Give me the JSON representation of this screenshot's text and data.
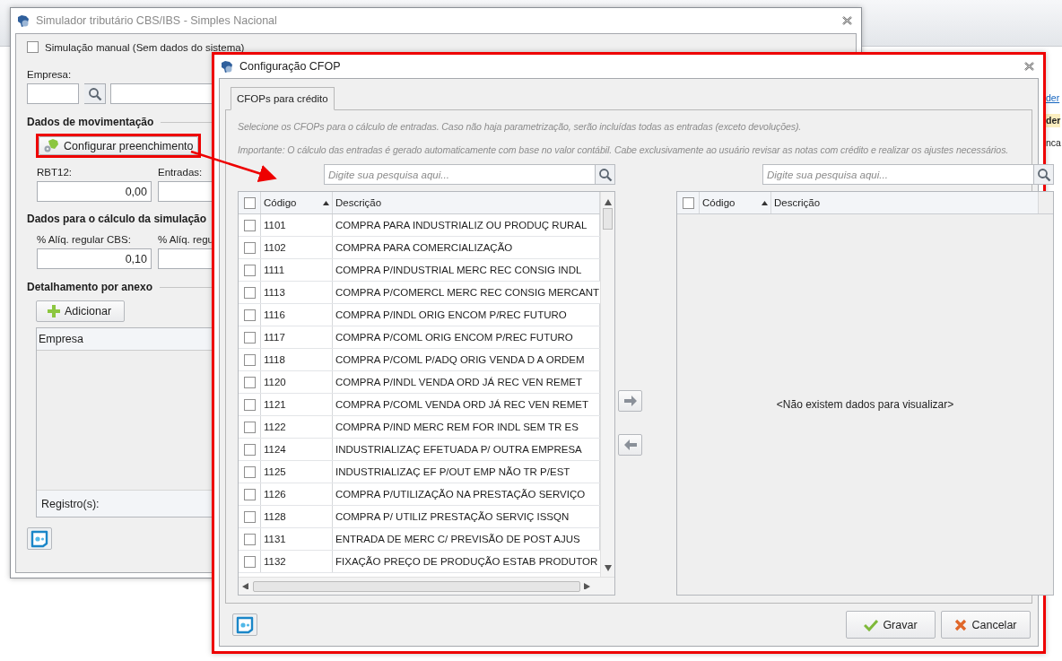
{
  "background": {
    "right_fragments": [
      {
        "text": "der",
        "kind": "link"
      },
      {
        "text": "der",
        "kind": "highlight"
      },
      {
        "text": "nca",
        "kind": "plain"
      }
    ]
  },
  "simulator": {
    "title": "Simulador tributário CBS/IBS - Simples Nacional",
    "manual": {
      "label": "Simulação manual (Sem dados do sistema)",
      "checked": false
    },
    "empresa_label": "Empresa:",
    "section_movement": "Dados de movimentação",
    "configure_button": "Configurar preenchimento",
    "rbt12": {
      "label": "RBT12:",
      "value": "0,00"
    },
    "entradas": {
      "label": "Entradas:"
    },
    "section_calc": "Dados para o cálculo da simulação",
    "cbs": {
      "label": "% Alíq. regular CBS:",
      "value": "0,10"
    },
    "ibs": {
      "label": "% Alíq. regu"
    },
    "section_annex": "Detalhamento por anexo",
    "add_button": "Adicionar",
    "table": {
      "column": "Empresa",
      "footer": "Registro(s):"
    }
  },
  "config": {
    "title": "Configuração CFOP",
    "tabs": [
      {
        "label": "CFOPs para crédito",
        "selected": true
      }
    ],
    "info": [
      "Selecione os CFOPs para o cálculo de entradas. Caso não haja parametrização, serão incluídas todas as entradas (exceto devoluções).",
      "Importante: O cálculo das entradas é gerado automaticamente com base no valor contábil. Cabe exclusivamente ao usuário revisar as notas com crédito e realizar os ajustes necessários."
    ],
    "available": {
      "search": {
        "placeholder": "Digite sua pesquisa aqui..."
      },
      "all_checked": false,
      "columns": [
        "Código",
        "Descrição"
      ],
      "rows": [
        {
          "code": "1101",
          "description": "COMPRA PARA INDUSTRIALIZ OU PRODUÇ RURAL",
          "checked": false
        },
        {
          "code": "1102",
          "description": "COMPRA PARA COMERCIALIZAÇÃO",
          "checked": false
        },
        {
          "code": "1111",
          "description": "COMPRA P/INDUSTRIAL MERC REC CONSIG INDL",
          "checked": false
        },
        {
          "code": "1113",
          "description": "COMPRA P/COMERCL MERC REC CONSIG MERCANT",
          "checked": false
        },
        {
          "code": "1116",
          "description": "COMPRA P/INDL ORIG ENCOM P/REC FUTURO",
          "checked": false
        },
        {
          "code": "1117",
          "description": "COMPRA P/COML ORIG ENCOM P/REC FUTURO",
          "checked": false
        },
        {
          "code": "1118",
          "description": "COMPRA P/COML P/ADQ ORIG VENDA D A ORDEM",
          "checked": false
        },
        {
          "code": "1120",
          "description": "COMPRA P/INDL VENDA ORD JÁ REC VEN REMET",
          "checked": false
        },
        {
          "code": "1121",
          "description": "COMPRA P/COML VENDA ORD JÁ REC VEN REMET",
          "checked": false
        },
        {
          "code": "1122",
          "description": "COMPRA P/IND MERC REM FOR INDL SEM TR ES",
          "checked": false
        },
        {
          "code": "1124",
          "description": "INDUSTRIALIZAÇ EFETUADA P/ OUTRA EMPRESA",
          "checked": false
        },
        {
          "code": "1125",
          "description": "INDUSTRIALIZAÇ EF P/OUT EMP NÃO TR P/EST",
          "checked": false
        },
        {
          "code": "1126",
          "description": "COMPRA P/UTILIZAÇÃO NA PRESTAÇÃO SERVIÇO",
          "checked": false
        },
        {
          "code": "1128",
          "description": "COMPRA P/ UTILIZ PRESTAÇÃO SERVIÇ ISSQN",
          "checked": false
        },
        {
          "code": "1131",
          "description": "ENTRADA DE MERC C/ PREVISÃO DE POST AJUS",
          "checked": false
        },
        {
          "code": "1132",
          "description": "FIXAÇÃO PREÇO DE PRODUÇÃO ESTAB PRODUTOR",
          "checked": false
        }
      ]
    },
    "selected": {
      "search": {
        "placeholder": "Digite sua pesquisa aqui..."
      },
      "all_checked": false,
      "columns": [
        "Código",
        "Descrição"
      ],
      "empty_message": "<Não existem dados para visualizar>"
    },
    "buttons": [
      {
        "label": "Gravar",
        "kind": "save"
      },
      {
        "label": "Cancelar",
        "kind": "cancel"
      }
    ]
  }
}
